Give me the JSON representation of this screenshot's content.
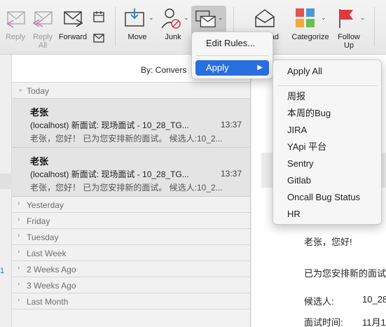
{
  "toolbar": {
    "reply": "Reply",
    "reply_all": "Reply\nAll",
    "reply_all_l1": "Reply",
    "reply_all_l2": "All",
    "forward": "Forward",
    "move": "Move",
    "junk": "Junk",
    "read_partial": "Read",
    "categorize": "Categorize",
    "follow_up_l1": "Follow",
    "follow_up_l2": "Up",
    "colors": {
      "categorize": [
        "#e5534b",
        "#f2a93b",
        "#4a9ad8",
        "#6cc04a"
      ],
      "flag": "#e0383e"
    }
  },
  "message_list": {
    "sort_label": "By: Convers",
    "groups_top": {
      "today": "Today"
    },
    "messages": [
      {
        "from": "老张",
        "subject": "(localhost) 新面试: 现场面试 - 10_28_TG...",
        "time": "13:37",
        "preview": "老张，您好！ 已为您安排新的面试。 候选人:10_2..."
      },
      {
        "from": "老张",
        "subject": "(localhost) 新面试: 现场面试 - 10_28_TG...",
        "time": "13:37",
        "preview": "老张，您好！ 已为您安排新的面试。 候选人:10_2..."
      }
    ],
    "groups": [
      "Yesterday",
      "Friday",
      "Tuesday",
      "Last Week",
      "2 Weeks Ago",
      "3 Weeks Ago",
      "Last Month"
    ]
  },
  "sidebar": {
    "badge": "1"
  },
  "reading_pane": {
    "greeting": "老张，您好!",
    "line2": "已为您安排新的面试",
    "candidate_label": "候选人:",
    "candidate_value": "10_28",
    "time_label": "面试时间:",
    "time_value": "11月1"
  },
  "rules_menu": {
    "edit_rules": "Edit Rules...",
    "apply": "Apply",
    "submenu": {
      "apply_all": "Apply All",
      "rules": [
        "周报",
        "本周的Bug",
        "JIRA",
        "YApi 平台",
        "Sentry",
        "Gitlab",
        "Oncall Bug Status",
        "HR"
      ]
    }
  }
}
